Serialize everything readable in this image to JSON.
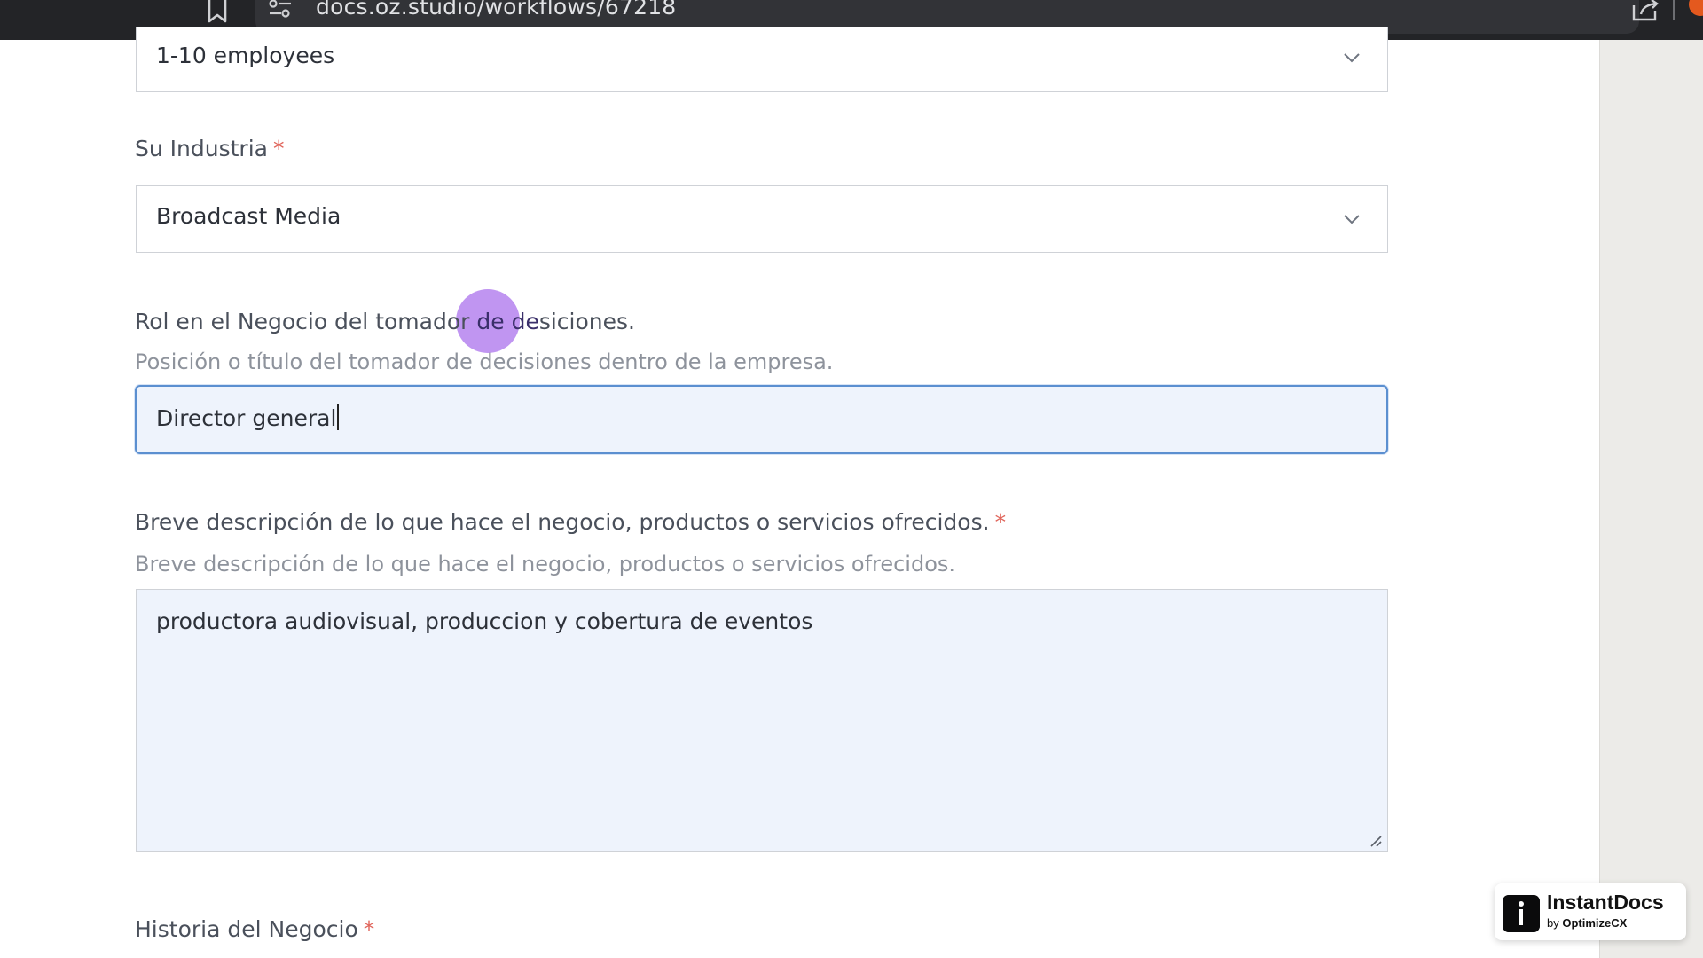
{
  "browser": {
    "url": "docs.oz.studio/workflows/67218"
  },
  "form": {
    "company_size": {
      "value": "1-10 employees"
    },
    "industry": {
      "label": "Su Industria",
      "required_mark": "*",
      "value": "Broadcast Media"
    },
    "role": {
      "label_start": "Rol en el Negocio del tomador ",
      "label_highlight": "de de",
      "label_end": "siciones.",
      "helper": "Posición o título del tomador de decisiones dentro de la empresa.",
      "value": "Director general"
    },
    "description": {
      "label": "Breve descripción de lo que hace el negocio, productos o servicios ofrecidos.",
      "required_mark": "*",
      "helper": "Breve descripción de lo que hace el negocio, productos o servicios ofrecidos.",
      "value": "productora audiovisual, produccion y cobertura de eventos"
    },
    "history": {
      "label": "Historia del Negocio",
      "required_mark": "*"
    }
  },
  "badge": {
    "title": "InstantDocs",
    "by": "by ",
    "brand": "OptimizeCX"
  },
  "colors": {
    "focus_border": "#5b8fd0",
    "field_fill": "#eef3fc",
    "required": "#e0645a",
    "cursor_highlight": "#a86cec"
  },
  "icons": [
    "bookmark-icon",
    "tune-icon",
    "share-icon",
    "chevron-down-icon",
    "resize-grip-icon",
    "instantdocs-logo-icon"
  ]
}
